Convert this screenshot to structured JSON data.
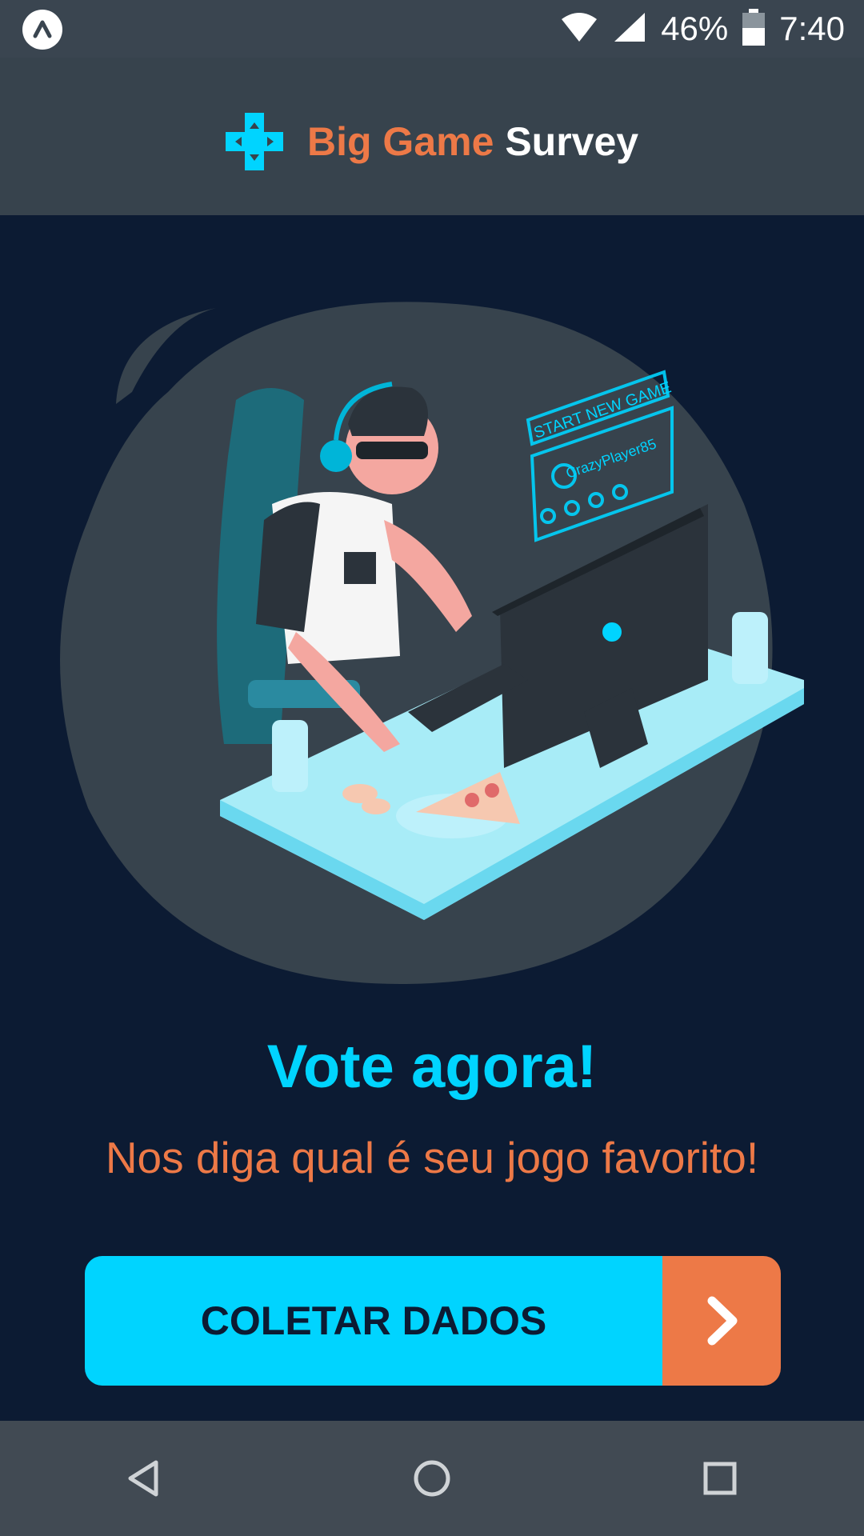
{
  "status_bar": {
    "battery": "46%",
    "time": "7:40",
    "icons": [
      "app-notification-icon",
      "wifi-icon",
      "signal-icon",
      "battery-icon"
    ]
  },
  "header": {
    "brand_part1": "Big Game",
    "brand_part2": "Survey",
    "logo_icon": "gamepad-dpad-icon"
  },
  "hero": {
    "screen_text_1": "START NEW GAME",
    "screen_text_2": "CrazyPlayer85"
  },
  "main": {
    "title": "Vote agora!",
    "subtitle": "Nos diga qual é seu jogo favorito!"
  },
  "cta": {
    "label": "COLETAR DADOS",
    "icon": "chevron-right-icon"
  },
  "colors": {
    "background": "#0c1b33",
    "header": "#37434d",
    "accent_cyan": "#00d4ff",
    "accent_orange": "#ed7947"
  },
  "nav_bar": {
    "icons": [
      "back-icon",
      "home-icon",
      "recents-icon"
    ]
  }
}
